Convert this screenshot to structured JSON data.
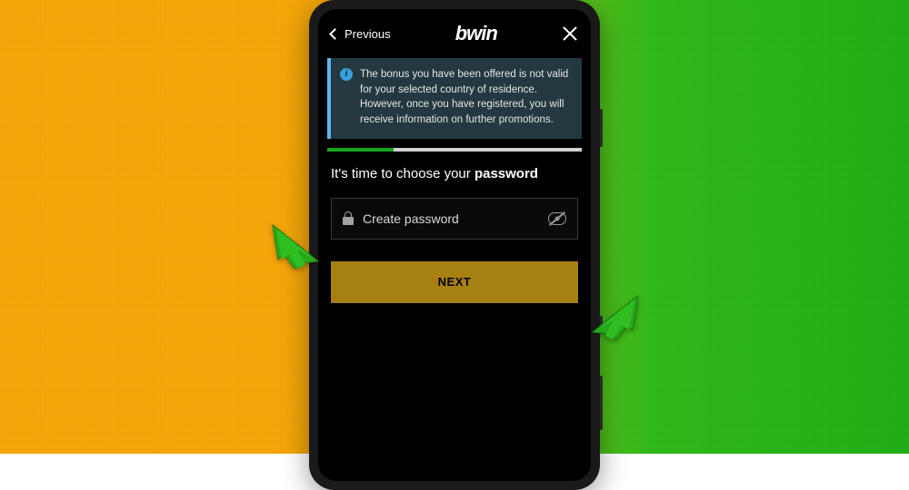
{
  "nav": {
    "back_label": "Previous",
    "logo_text": "bwin"
  },
  "info": {
    "message": "The bonus you have been offered is not valid for your selected country of residence. However, once you have registered, you will receive information on further promotions."
  },
  "progress": {
    "percent": 26
  },
  "heading": {
    "prefix": "It's time to choose your ",
    "bold": "password"
  },
  "password_field": {
    "placeholder": "Create password",
    "value": ""
  },
  "buttons": {
    "next_label": "NEXT"
  },
  "colors": {
    "accent_green": "#1aa51e",
    "next_btn_bg": "#a68012",
    "info_bg": "#23383f",
    "info_border": "#5bb5e8"
  }
}
